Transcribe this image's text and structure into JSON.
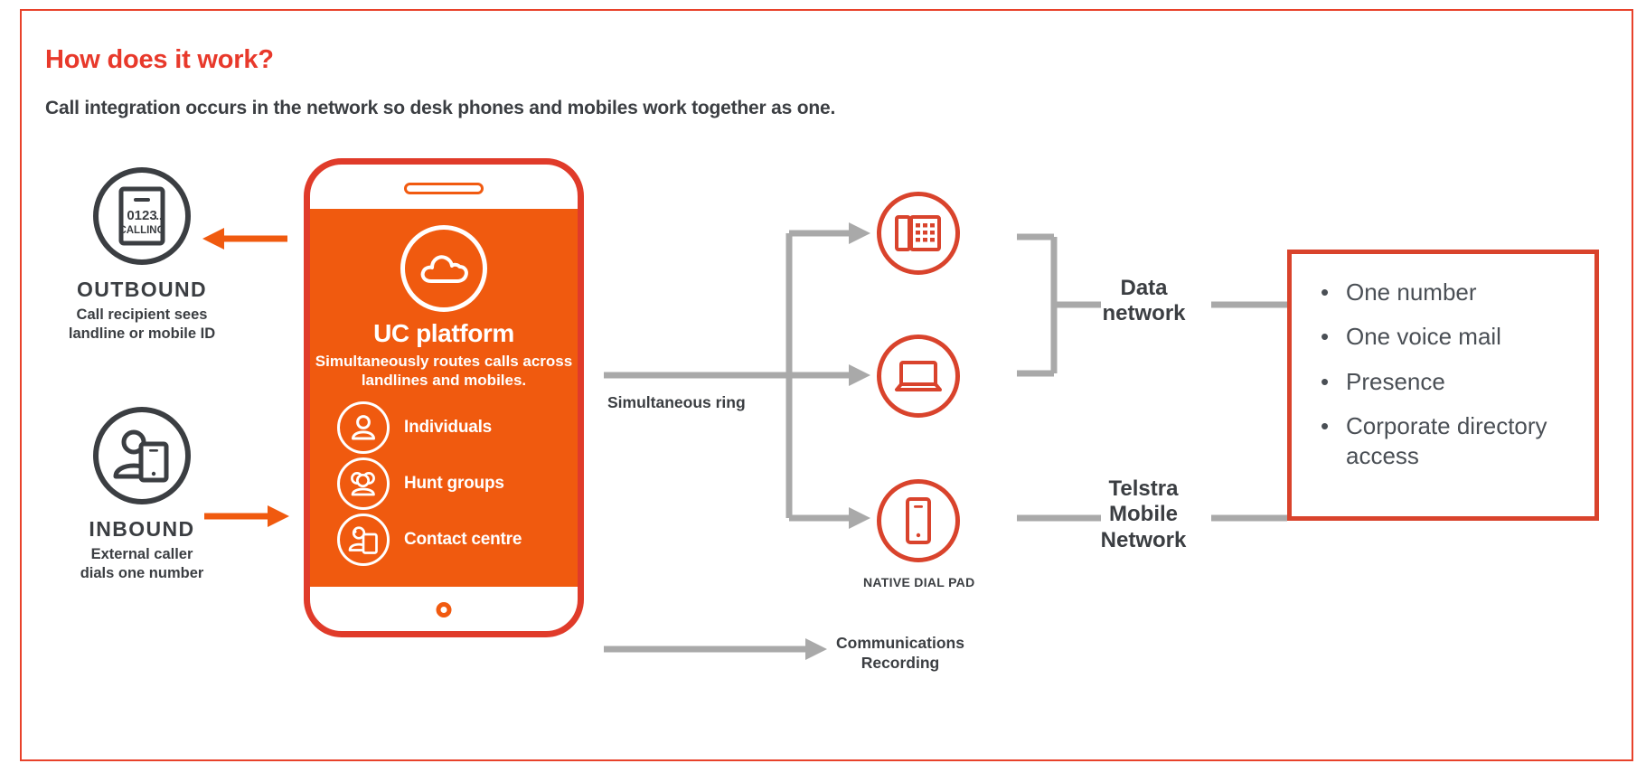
{
  "heading": {
    "title": "How does it work?",
    "subtitle": "Call integration occurs in the network so desk phones and mobiles work together as one."
  },
  "colors": {
    "brand_red": "#e8392b",
    "brand_orange": "#f05a0f",
    "device_red": "#d9432c",
    "dark_text": "#3b3e42",
    "connector_grey": "#a9a9a9"
  },
  "left_column": {
    "outbound": {
      "icon": "phone-calling-icon",
      "screen_number": "0123...",
      "screen_status": "CALLING",
      "title": "OUTBOUND",
      "description_line1": "Call recipient sees",
      "description_line2": "landline or mobile ID",
      "arrow_direction": "left"
    },
    "inbound": {
      "icon": "person-with-mobile-icon",
      "title": "INBOUND",
      "description_line1": "External caller",
      "description_line2": "dials one number",
      "arrow_direction": "right"
    }
  },
  "phone": {
    "platform_icon": "cloud-icon",
    "platform_title": "UC platform",
    "platform_description": "Simultaneously routes calls across landlines and mobiles.",
    "features": [
      {
        "icon": "single-person-icon",
        "label": "Individuals"
      },
      {
        "icon": "group-people-icon",
        "label": "Hunt groups"
      },
      {
        "icon": "headset-agent-icon",
        "label": "Contact centre"
      }
    ]
  },
  "flows": {
    "simultaneous_ring": "Simultaneous ring",
    "communications_recording_line1": "Communications",
    "communications_recording_line2": "Recording"
  },
  "devices": [
    {
      "icon": "desk-phone-icon",
      "caption": ""
    },
    {
      "icon": "laptop-icon",
      "caption": ""
    },
    {
      "icon": "mobile-phone-icon",
      "caption": "NATIVE DIAL PAD"
    }
  ],
  "networks": {
    "data_network_line1": "Data",
    "data_network_line2": "network",
    "mobile_network_line1": "Telstra",
    "mobile_network_line2": "Mobile",
    "mobile_network_line3": "Network"
  },
  "benefits": [
    "One number",
    "One voice mail",
    "Presence",
    "Corporate directory access"
  ]
}
